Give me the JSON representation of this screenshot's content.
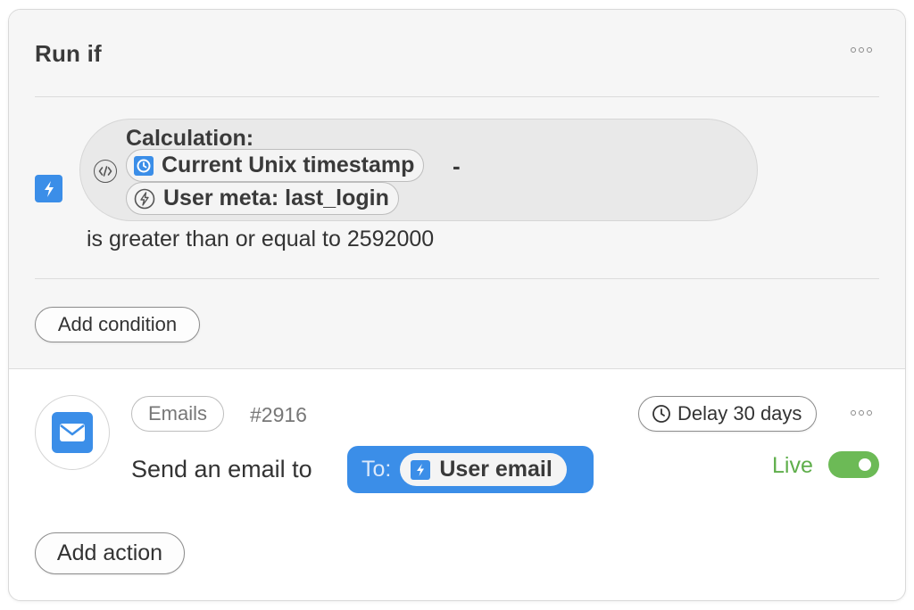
{
  "condition": {
    "title": "Run if",
    "calculation_label": "Calculation:",
    "token_a": "Current Unix timestamp",
    "operator": "-",
    "token_b": "User meta: last_login",
    "comparison": "is greater than or equal to 2592000",
    "add_condition_label": "Add condition"
  },
  "action": {
    "category": "Emails",
    "id": "#2916",
    "delay_label": "Delay 30 days",
    "sentence": "Send an email to",
    "to_label": "To:",
    "recipient": "User email",
    "status_label": "Live",
    "status_on": true,
    "add_action_label": "Add action"
  },
  "icons": {
    "trigger": "lightning-bolt-icon",
    "calculation": "code-icon",
    "timestamp": "clock-icon",
    "user_meta": "bolt-circle-icon",
    "email": "envelope-icon",
    "delay": "clock-icon",
    "more": "more-options-icon"
  },
  "colors": {
    "accent": "#3b8ee8",
    "live_green": "#6cba56",
    "section_bg": "#f6f6f6"
  }
}
